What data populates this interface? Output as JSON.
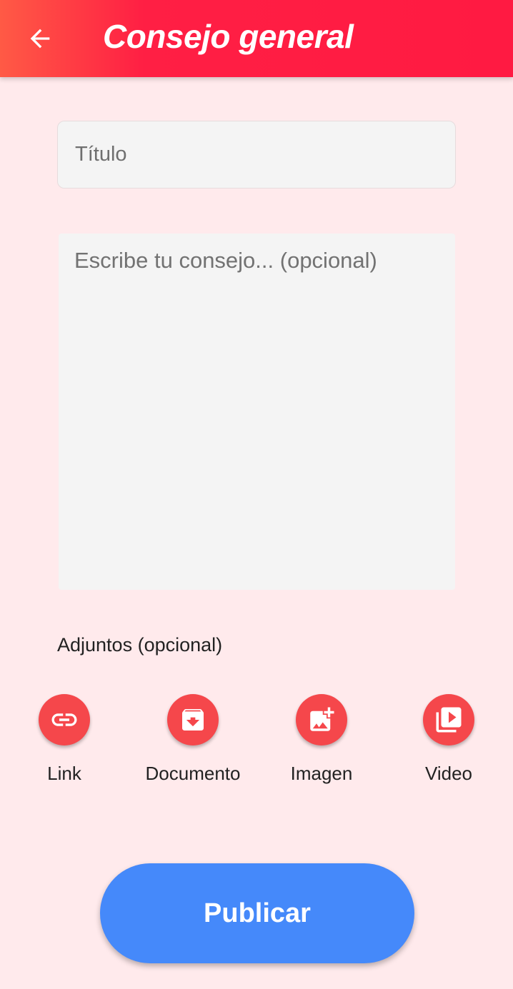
{
  "appbar": {
    "title": "Consejo general",
    "back_icon": "arrow-back-icon"
  },
  "form": {
    "title_placeholder": "Título",
    "title_value": "",
    "body_placeholder": "Escribe tu consejo... (opcional)",
    "body_value": ""
  },
  "attachments": {
    "label": "Adjuntos (opcional)",
    "items": [
      {
        "label": "Link",
        "icon": "link-icon"
      },
      {
        "label": "Documento",
        "icon": "document-download-icon"
      },
      {
        "label": "Imagen",
        "icon": "add-image-icon"
      },
      {
        "label": "Video",
        "icon": "video-library-icon"
      }
    ]
  },
  "publish": {
    "label": "Publicar"
  },
  "colors": {
    "appbar": "#ff1f44",
    "background": "#ffeaec",
    "attach_button": "#f5474b",
    "publish_button": "#4589fa"
  }
}
